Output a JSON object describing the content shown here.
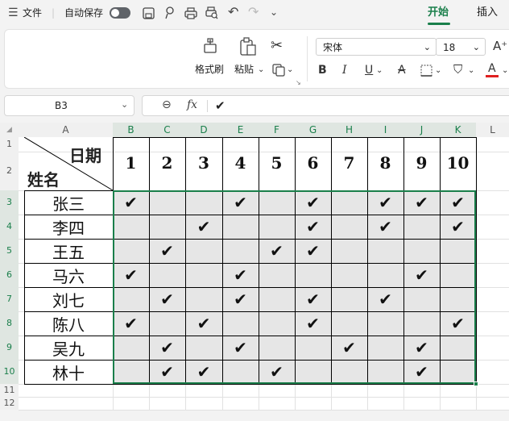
{
  "menu": {
    "file_label": "文件",
    "autosave_label": "自动保存",
    "tabs": [
      {
        "label": "开始",
        "active": true
      },
      {
        "label": "插入",
        "active": false
      }
    ]
  },
  "ribbon": {
    "format_painter_label": "格式刷",
    "paste_label": "粘贴",
    "font_name": "宋体",
    "font_size": "18"
  },
  "formula_bar": {
    "cell_reference": "B3",
    "fx_label": "fx",
    "content": "✔"
  },
  "sheet": {
    "columns": [
      "A",
      "B",
      "C",
      "D",
      "E",
      "F",
      "G",
      "H",
      "I",
      "J",
      "K",
      "L"
    ],
    "rows": [
      "1",
      "2",
      "3",
      "4",
      "5",
      "6",
      "7",
      "8",
      "9",
      "10",
      "11",
      "12"
    ],
    "header_date": "日期",
    "header_name": "姓名",
    "date_numbers": [
      "1",
      "2",
      "3",
      "4",
      "5",
      "6",
      "7",
      "8",
      "9",
      "10"
    ],
    "check_mark": "✔",
    "accent_color": "#1a7f4b",
    "people": [
      {
        "name": "张三",
        "checks": [
          1,
          0,
          0,
          1,
          0,
          1,
          0,
          1,
          1,
          1
        ]
      },
      {
        "name": "李四",
        "checks": [
          0,
          0,
          1,
          0,
          0,
          1,
          0,
          1,
          0,
          1
        ]
      },
      {
        "name": "王五",
        "checks": [
          0,
          1,
          0,
          0,
          1,
          1,
          0,
          0,
          0,
          0
        ]
      },
      {
        "name": "马六",
        "checks": [
          1,
          0,
          0,
          1,
          0,
          0,
          0,
          0,
          1,
          0
        ]
      },
      {
        "name": "刘七",
        "checks": [
          0,
          1,
          0,
          1,
          0,
          1,
          0,
          1,
          0,
          0
        ]
      },
      {
        "name": "陈八",
        "checks": [
          1,
          0,
          1,
          0,
          0,
          1,
          0,
          0,
          0,
          1
        ]
      },
      {
        "name": "吴九",
        "checks": [
          0,
          1,
          0,
          1,
          0,
          0,
          1,
          0,
          1,
          0
        ]
      },
      {
        "name": "林十",
        "checks": [
          0,
          1,
          1,
          0,
          1,
          0,
          0,
          0,
          1,
          0
        ]
      }
    ]
  }
}
